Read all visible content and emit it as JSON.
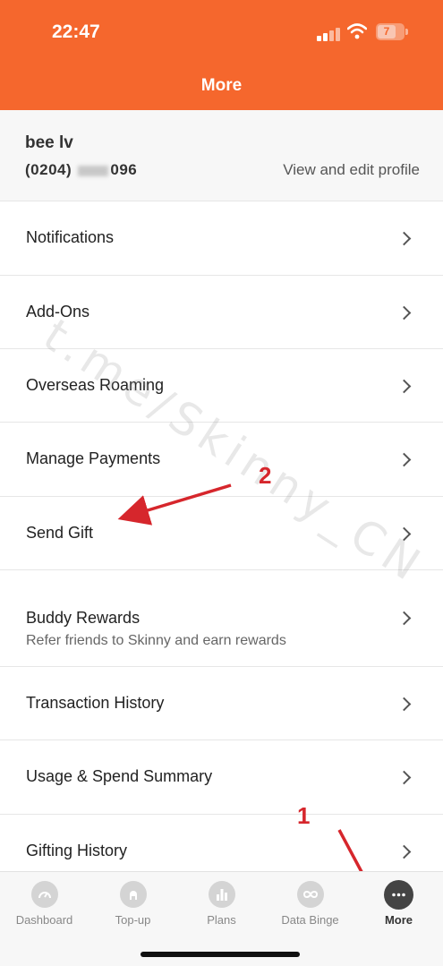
{
  "status_bar": {
    "time": "22:47",
    "battery_level": "7"
  },
  "header": {
    "title": "More"
  },
  "profile": {
    "name": "bee lv",
    "phone_prefix": "(0204)",
    "phone_suffix": "096",
    "edit_link": "View and edit profile"
  },
  "menu": [
    {
      "label": "Notifications"
    },
    {
      "label": "Add-Ons"
    },
    {
      "label": "Overseas Roaming"
    },
    {
      "label": "Manage Payments"
    },
    {
      "label": "Send Gift"
    },
    {
      "label": "Buddy Rewards",
      "subtitle": "Refer friends to Skinny and earn rewards"
    },
    {
      "label": "Transaction History"
    },
    {
      "label": "Usage & Spend Summary"
    },
    {
      "label": "Gifting History"
    }
  ],
  "watermark": "t.me/Skinny_CN",
  "annotations": {
    "step1": "1",
    "step2": "2",
    "color": "#d6262c"
  },
  "tabs": [
    {
      "label": "Dashboard",
      "icon": "gauge-icon"
    },
    {
      "label": "Top-up",
      "icon": "top-up-icon"
    },
    {
      "label": "Plans",
      "icon": "bar-chart-icon"
    },
    {
      "label": "Data Binge",
      "icon": "infinity-icon"
    },
    {
      "label": "More",
      "icon": "more-dots-icon",
      "active": true
    }
  ],
  "colors": {
    "brand": "#f5672d",
    "arrow": "#d6262c"
  }
}
